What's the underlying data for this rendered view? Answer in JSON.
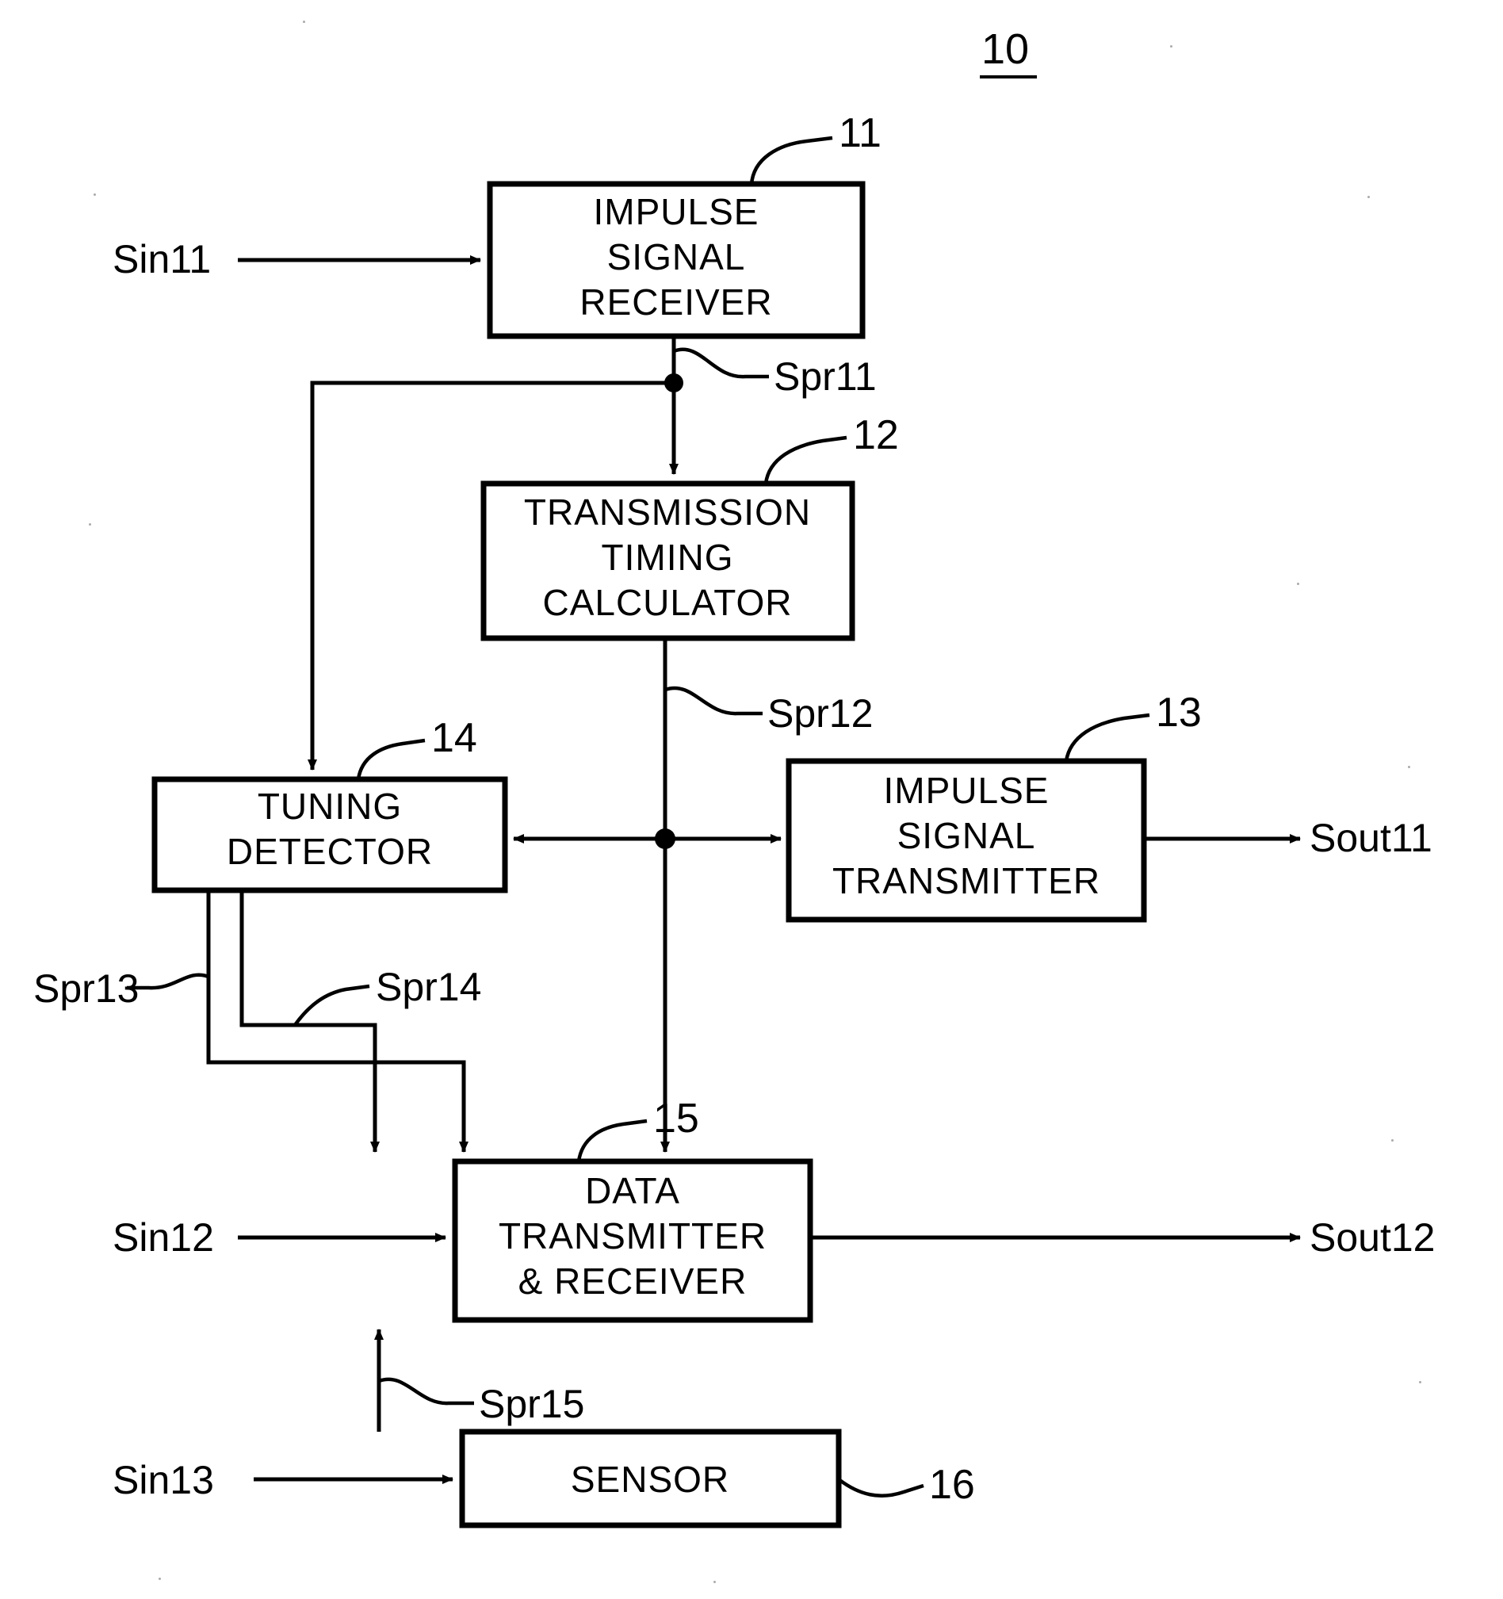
{
  "figure": {
    "title_number": "10",
    "blocks": [
      {
        "id": "11",
        "ref": "11",
        "lines": [
          "IMPULSE",
          "SIGNAL",
          "RECEIVER"
        ]
      },
      {
        "id": "12",
        "ref": "12",
        "lines": [
          "TRANSMISSION",
          "TIMING",
          "CALCULATOR"
        ]
      },
      {
        "id": "13",
        "ref": "13",
        "lines": [
          "IMPULSE",
          "SIGNAL",
          "TRANSMITTER"
        ]
      },
      {
        "id": "14",
        "ref": "14",
        "lines": [
          "TUNING",
          "DETECTOR"
        ]
      },
      {
        "id": "15",
        "ref": "15",
        "lines": [
          "DATA",
          "TRANSMITTER",
          "&  RECEIVER"
        ]
      },
      {
        "id": "16",
        "ref": "16",
        "lines": [
          "SENSOR"
        ]
      }
    ],
    "signals": {
      "sin11": "Sin11",
      "sin12": "Sin12",
      "sin13": "Sin13",
      "sout11": "Sout11",
      "sout12": "Sout12",
      "spr11": "Spr11",
      "spr12": "Spr12",
      "spr13": "Spr13",
      "spr14": "Spr14",
      "spr15": "Spr15"
    }
  }
}
